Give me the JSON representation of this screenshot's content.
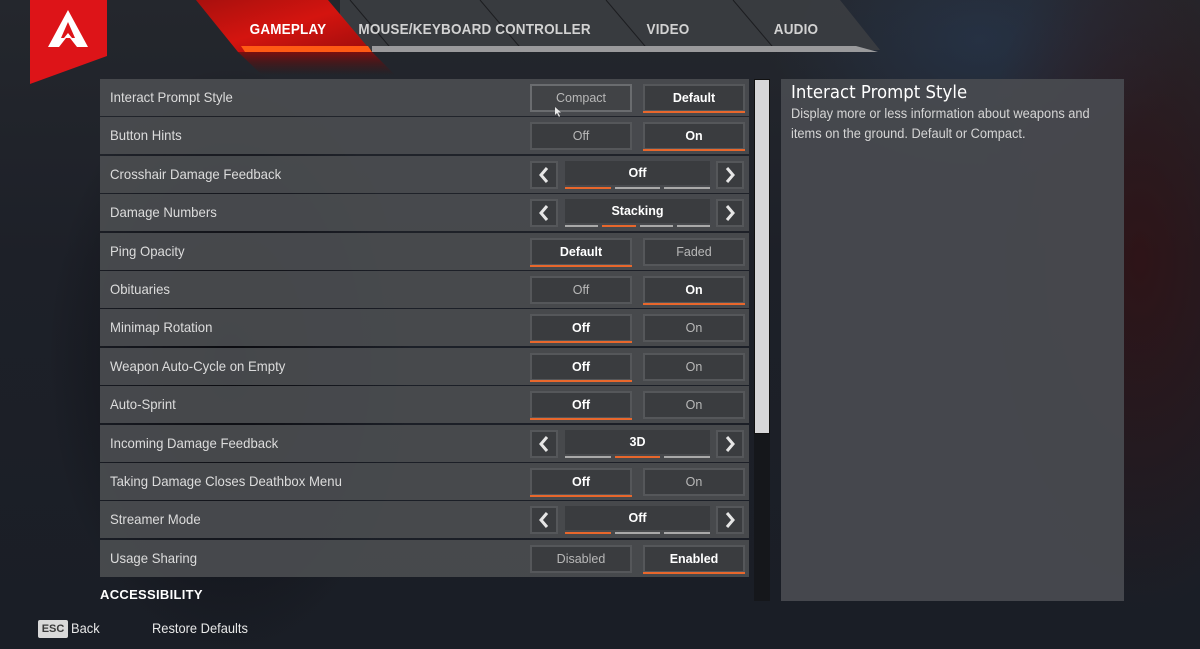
{
  "colors": {
    "accent_orange": "#e8672c",
    "brand_red": "#d8111a",
    "tab_active_red": "#c8120f"
  },
  "logo": {
    "icon": "apex-legends-logo-icon"
  },
  "tabs": [
    {
      "label": "GAMEPLAY",
      "active": true
    },
    {
      "label": "MOUSE/KEYBOARD",
      "active": false
    },
    {
      "label": "CONTROLLER",
      "active": false
    },
    {
      "label": "VIDEO",
      "active": false
    },
    {
      "label": "AUDIO",
      "active": false
    }
  ],
  "settings": [
    {
      "label": "Interact Prompt Style",
      "type": "toggle",
      "options": [
        "Compact",
        "Default"
      ],
      "selected": "Default"
    },
    {
      "label": "Button Hints",
      "type": "toggle",
      "options": [
        "Off",
        "On"
      ],
      "selected": "On"
    },
    {
      "label": "Crosshair Damage Feedback",
      "type": "cycle",
      "value": "Off",
      "option_count": 3,
      "selected_index": 0,
      "arrow_left": "‹",
      "arrow_right": "›"
    },
    {
      "label": "Damage Numbers",
      "type": "cycle",
      "value": "Stacking",
      "option_count": 4,
      "selected_index": 1,
      "arrow_left": "‹",
      "arrow_right": "›"
    },
    {
      "label": "Ping Opacity",
      "type": "toggle",
      "options": [
        "Default",
        "Faded"
      ],
      "selected": "Default"
    },
    {
      "label": "Obituaries",
      "type": "toggle",
      "options": [
        "Off",
        "On"
      ],
      "selected": "On"
    },
    {
      "label": "Minimap Rotation",
      "type": "toggle",
      "options": [
        "Off",
        "On"
      ],
      "selected": "Off"
    },
    {
      "label": "Weapon Auto-Cycle on Empty",
      "type": "toggle",
      "options": [
        "Off",
        "On"
      ],
      "selected": "Off"
    },
    {
      "label": "Auto-Sprint",
      "type": "toggle",
      "options": [
        "Off",
        "On"
      ],
      "selected": "Off"
    },
    {
      "label": "Incoming Damage Feedback",
      "type": "cycle",
      "value": "3D",
      "option_count": 3,
      "selected_index": 1,
      "arrow_left": "‹",
      "arrow_right": "›"
    },
    {
      "label": "Taking Damage Closes Deathbox Menu",
      "type": "toggle",
      "options": [
        "Off",
        "On"
      ],
      "selected": "Off"
    },
    {
      "label": "Streamer Mode",
      "type": "cycle",
      "value": "Off",
      "option_count": 3,
      "selected_index": 0,
      "arrow_left": "‹",
      "arrow_right": "›"
    },
    {
      "label": "Usage Sharing",
      "type": "toggle",
      "options": [
        "Disabled",
        "Enabled"
      ],
      "selected": "Enabled"
    }
  ],
  "scrollbar": {
    "visible_fraction": 0.68,
    "position": 0.0
  },
  "description": {
    "title": "Interact Prompt Style",
    "body": "Display more or less information about weapons and items on the ground.  Default or Compact."
  },
  "footer": {
    "section_heading": "ACCESSIBILITY",
    "esc_key": "ESC",
    "back_label": "Back",
    "restore_label": "Restore Defaults"
  }
}
